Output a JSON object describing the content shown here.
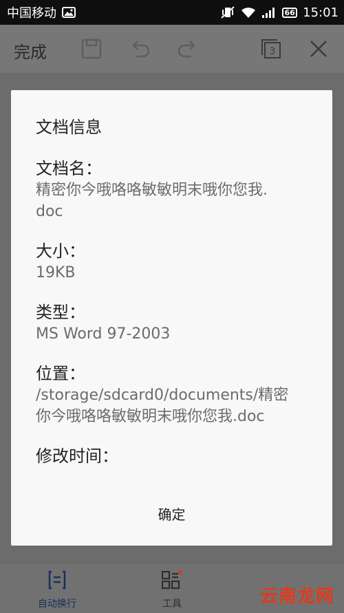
{
  "status_bar": {
    "carrier": "中国移动",
    "battery": "66",
    "time": "15:01"
  },
  "toolbar": {
    "done_label": "完成",
    "page_count": "3"
  },
  "dialog": {
    "title": "文档信息",
    "fields": [
      {
        "label": "文档名：",
        "value_lines": [
          "精密你今哦咯咯敏敏明末哦你您我.",
          "doc"
        ]
      },
      {
        "label": "大小：",
        "value_lines": [
          "19KB"
        ]
      },
      {
        "label": "类型：",
        "value_lines": [
          "MS Word 97-2003"
        ]
      },
      {
        "label": "位置：",
        "value_lines": [
          "/storage/sdcard0/documents/精密",
          "你今哦咯咯敏敏明末哦你您我.doc"
        ]
      },
      {
        "label": "修改时间：",
        "value_lines": []
      }
    ],
    "ok_label": "确定"
  },
  "bottom_bar": {
    "items": [
      {
        "label": "自动换行",
        "icon": "wrap-text-icon",
        "active": true
      },
      {
        "label": "工具",
        "icon": "tools-grid-icon",
        "active": false
      }
    ]
  },
  "watermark": "云南龙网",
  "colors": {
    "accent": "#1a2f5a",
    "watermark": "#e23a1d",
    "notification_dot": "#d63a2a"
  }
}
